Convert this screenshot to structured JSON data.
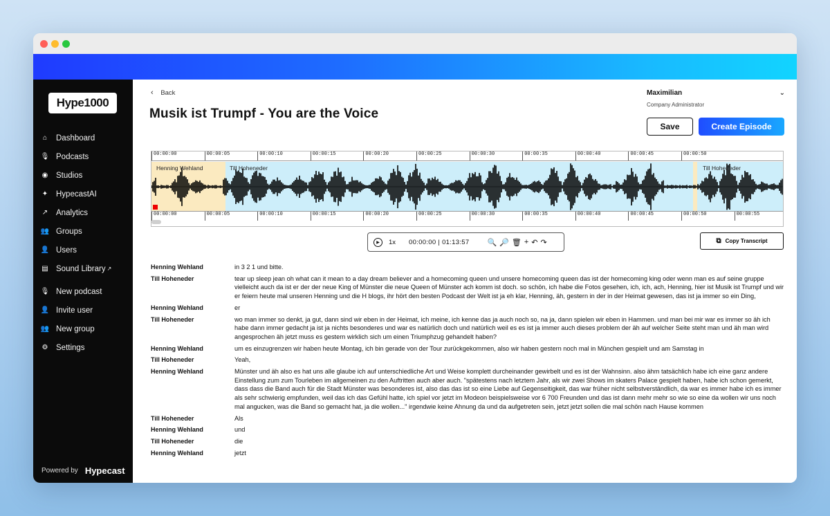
{
  "sidebar": {
    "logo": "Hype1000",
    "items": [
      {
        "icon": "home-icon",
        "label": "Dashboard"
      },
      {
        "icon": "microphone-icon",
        "label": "Podcasts"
      },
      {
        "icon": "record-icon",
        "label": "Studios"
      },
      {
        "icon": "sparkle-icon",
        "label": "HypecastAI"
      },
      {
        "icon": "chart-icon",
        "label": "Analytics"
      },
      {
        "icon": "group-icon",
        "label": "Groups"
      },
      {
        "icon": "user-icon",
        "label": "Users"
      },
      {
        "icon": "library-icon",
        "label": "Sound Library"
      }
    ],
    "actions": [
      {
        "icon": "new-podcast-icon",
        "label": "New podcast"
      },
      {
        "icon": "invite-user-icon",
        "label": "Invite user"
      },
      {
        "icon": "new-group-icon",
        "label": "New group"
      },
      {
        "icon": "settings-icon",
        "label": "Settings"
      }
    ],
    "powered_by": "Powered by",
    "powered_brand": "Hypecast"
  },
  "header": {
    "back": "Back",
    "title": "Musik ist Trumpf - You are the Voice",
    "user_name": "Maximilian",
    "user_role": "Company Administrator",
    "save": "Save",
    "create": "Create Episode"
  },
  "waveform": {
    "ticks_top": [
      "00:00:00",
      "00:00:05",
      "00:00:10",
      "00:00:15",
      "00:00:20",
      "00:00:25",
      "00:00:30",
      "00:00:35",
      "00:00:40",
      "00:00:45",
      "00:00:50"
    ],
    "ticks_bottom": [
      "00:00:00",
      "00:00:05",
      "00:00:10",
      "00:00:15",
      "00:00:20",
      "00:00:25",
      "00:00:30",
      "00:00:35",
      "00:00:40",
      "00:00:45",
      "00:00:50",
      "00:00:55"
    ],
    "speakers": [
      "Henning Wehland",
      "Till Hoheneder",
      "Till Hoheneder"
    ],
    "colors": {
      "henning": "#fbeac0",
      "till": "#cdeefa"
    }
  },
  "player": {
    "rate": "1x",
    "time": "00:00:00 | 01:13:57",
    "copy": "Copy Transcript"
  },
  "transcript": [
    {
      "speaker": "Henning Wehland",
      "text": "in 3 2 1 und bitte."
    },
    {
      "speaker": "Till Hoheneder",
      "text": "tear up sleep jean oh what can it mean to a day dream believer and a homecoming queen und unsere homecoming queen das ist der homecoming king oder wenn man es auf seine gruppe vielleicht auch da ist er der der neue King of Münster die neue Queen of Münster ach komm ist doch. so schön, ich habe die Fotos gesehen, ich, ich, ach, Henning, hier ist Musik ist Trumpf und wir er feiern heute mal unseren Henning und die H blogs, ihr hört den besten Podcast der Welt ist ja eh klar, Henning, äh, gestern in der in der Heimat gewesen, das ist ja immer so ein Ding,"
    },
    {
      "speaker": "Henning Wehland",
      "text": "er"
    },
    {
      "speaker": "Till Hoheneder",
      "text": "wo man immer so denkt, ja gut, dann sind wir eben in der Heimat, ich meine, ich kenne das ja auch noch so, na ja, dann spielen wir eben in Hammen. und man bei mir war es immer so äh ich habe dann immer gedacht ja ist ja nichts besonderes und war es natürlich doch und natürlich weil es es ist ja immer auch dieses problem der äh auf welcher Seite steht man und äh man wird angesprochen äh jetzt muss es gestern wirklich sich um einen Triumphzug gehandelt haben?"
    },
    {
      "speaker": "Henning Wehland",
      "text": "um es einzugrenzen wir haben heute Montag, ich bin gerade von der Tour zurückgekommen, also wir haben gestern noch mal in München gespielt und am Samstag in"
    },
    {
      "speaker": "Till Hoheneder",
      "text": "Yeah,"
    },
    {
      "speaker": "Henning Wehland",
      "text": "Münster und äh also es hat uns alle glaube ich auf unterschiedliche Art und Weise komplett durcheinander gewirbelt und es ist der Wahnsinn. also ähm tatsächlich habe ich eine ganz andere Einstellung zum zum Tourleben im allgemeinen zu den Auftritten auch aber auch. \"spätestens nach letztem Jahr, als wir zwei Shows im skaters Palace gespielt haben, habe ich schon gemerkt, dass dass die Band auch für die Stadt Münster was besonderes ist, also das das ist so eine Liebe auf Gegenseitigkeit, das war früher nicht selbstverständlich, da war es immer habe ich es immer als sehr schwierig empfunden, weil das ich das Gefühl hatte, ich spiel vor jetzt im Modeon beispielsweise vor 6 700 Freunden und das ist dann mehr mehr so wie so eine da wollen wir uns noch mal angucken, was die Band so gemacht hat, ja die wollen...\" irgendwie keine Ahnung da und da aufgetreten sein, jetzt jetzt sollen die mal schön nach Hause kommen"
    },
    {
      "speaker": "Till Hoheneder",
      "text": "Als"
    },
    {
      "speaker": "Henning Wehland",
      "text": "und"
    },
    {
      "speaker": "Till Hoheneder",
      "text": "die"
    },
    {
      "speaker": "Henning Wehland",
      "text": "jetzt"
    }
  ]
}
